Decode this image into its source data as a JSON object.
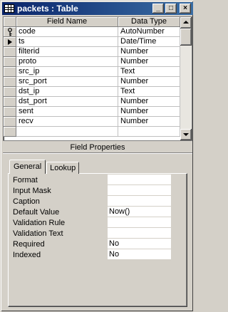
{
  "window": {
    "title": "packets : Table",
    "controls": {
      "minimize": "_",
      "maximize": "□",
      "close": "×"
    }
  },
  "grid": {
    "columns": [
      "Field Name",
      "Data Type"
    ],
    "rows": [
      {
        "name": "code",
        "type": "AutoNumber",
        "selector": "key-icon"
      },
      {
        "name": "ts",
        "type": "Date/Time",
        "selector": "current-row-arrow-icon"
      },
      {
        "name": "filterid",
        "type": "Number",
        "selector": ""
      },
      {
        "name": "proto",
        "type": "Number",
        "selector": ""
      },
      {
        "name": "src_ip",
        "type": "Text",
        "selector": ""
      },
      {
        "name": "src_port",
        "type": "Number",
        "selector": ""
      },
      {
        "name": "dst_ip",
        "type": "Text",
        "selector": ""
      },
      {
        "name": "dst_port",
        "type": "Number",
        "selector": ""
      },
      {
        "name": "sent",
        "type": "Number",
        "selector": ""
      },
      {
        "name": "recv",
        "type": "Number",
        "selector": ""
      },
      {
        "name": "",
        "type": "",
        "selector": ""
      }
    ]
  },
  "field_properties": {
    "header": "Field Properties",
    "tabs": [
      {
        "label": "General",
        "active": true
      },
      {
        "label": "Lookup",
        "active": false
      }
    ],
    "properties": [
      {
        "label": "Format",
        "value": ""
      },
      {
        "label": "Input Mask",
        "value": ""
      },
      {
        "label": "Caption",
        "value": ""
      },
      {
        "label": "Default Value",
        "value": "Now()"
      },
      {
        "label": "Validation Rule",
        "value": ""
      },
      {
        "label": "Validation Text",
        "value": ""
      },
      {
        "label": "Required",
        "value": "No"
      },
      {
        "label": "Indexed",
        "value": "No"
      }
    ]
  }
}
